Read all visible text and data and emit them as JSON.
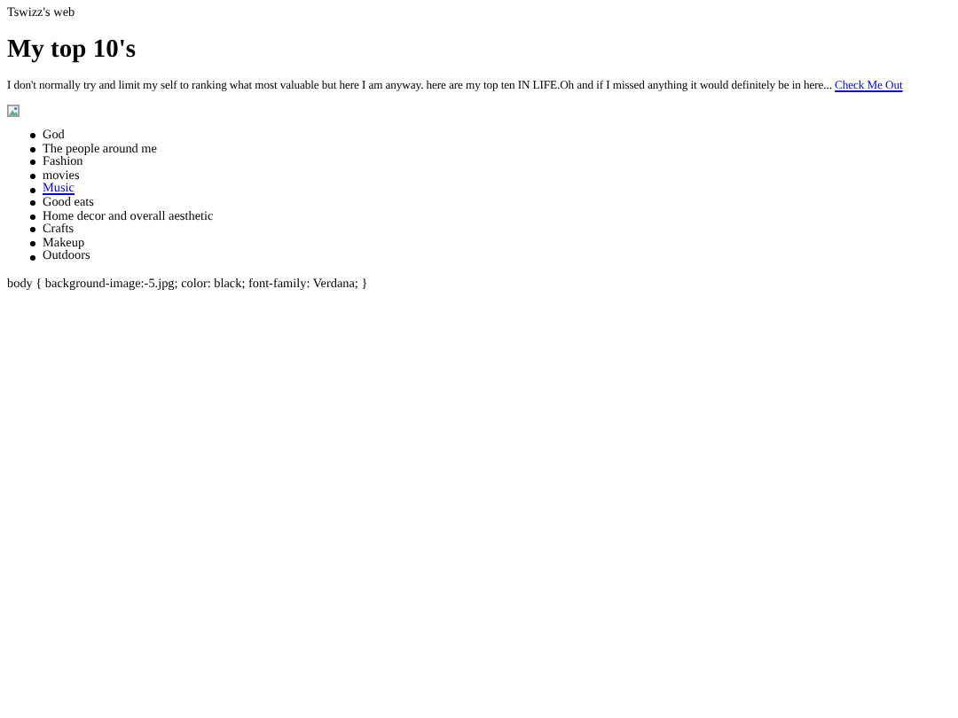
{
  "site_name": "Tswizz's web",
  "heading": "My top 10's",
  "intro": {
    "text": "I don't normally try and limit my self to ranking what most valuable but here I am anyway. here are my top ten IN LIFE.Oh and if I missed anything it would definitely be in here...",
    "link": "Check Me Out"
  },
  "image": {
    "kind": "broken-image"
  },
  "list": [
    {
      "label": "God",
      "kind": "text"
    },
    {
      "label": "The people around me",
      "kind": "text"
    },
    {
      "label": "Fashion",
      "kind": "text"
    },
    {
      "label": "movies",
      "kind": "text"
    },
    {
      "label": "Music",
      "kind": "link"
    },
    {
      "label": "Good eats",
      "kind": "text"
    },
    {
      "label": "Home decor and overall aesthetic",
      "kind": "text"
    },
    {
      "label": "Crafts",
      "kind": "text"
    },
    {
      "label": "Makeup",
      "kind": "text"
    },
    {
      "label": "Outdoors",
      "kind": "text"
    }
  ],
  "css_text": "body { background-image:-5.jpg; color: black; font-family: Verdana; }"
}
